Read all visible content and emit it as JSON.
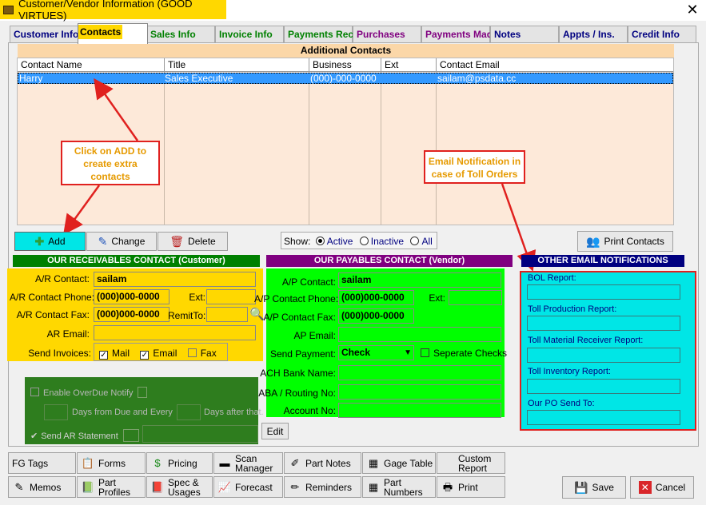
{
  "window": {
    "title": "Customer/Vendor Information  (GOOD VIRTUES)",
    "close": "✕"
  },
  "tabs": [
    {
      "label": "Customer Info",
      "color": "#000080"
    },
    {
      "label": "Contacts",
      "color": "#000000"
    },
    {
      "label": "Sales Info",
      "color": "#008000"
    },
    {
      "label": "Invoice Info",
      "color": "#008000"
    },
    {
      "label": "Payments Rec",
      "color": "#008000"
    },
    {
      "label": "Purchases",
      "color": "#800080"
    },
    {
      "label": "Payments Made",
      "color": "#800080"
    },
    {
      "label": "Notes",
      "color": "#000080"
    },
    {
      "label": "Appts / Ins.",
      "color": "#000080"
    },
    {
      "label": "Credit Info",
      "color": "#000080"
    }
  ],
  "additional_contacts": {
    "header": "Additional Contacts",
    "columns": [
      "Contact Name",
      "Title",
      "Business Phone",
      "Ext",
      "Contact Email"
    ],
    "rows": [
      [
        "Harry",
        "Sales Executive",
        "(000)-000-0000",
        "",
        "sailam@psdata.cc"
      ]
    ]
  },
  "callouts": {
    "add": "Click on ADD to create extra contacts",
    "email": "Email Notification in case of Toll Orders"
  },
  "actions": {
    "add": "Add",
    "change": "Change",
    "delete": "Delete",
    "print_contacts": "Print Contacts"
  },
  "show_filter": {
    "label": "Show:",
    "options": [
      "Active",
      "Inactive",
      "All"
    ],
    "selected": "Active"
  },
  "receivables": {
    "header": "OUR RECEIVABLES CONTACT (Customer)",
    "contact_label": "A/R Contact:",
    "contact": "sailam",
    "phone_label": "A/R Contact Phone:",
    "phone": "(000)000-0000",
    "ext_label": "Ext:",
    "ext": "",
    "fax_label": "A/R Contact Fax:",
    "fax": "(000)000-0000",
    "remit_label": "RemitTo:",
    "remit": "",
    "email_label": "AR Email:",
    "email": "",
    "send_label": "Send Invoices:",
    "send_mail": "Mail",
    "send_email": "Email",
    "send_fax": "Fax"
  },
  "overdue": {
    "enable": "Enable OverDue Notify",
    "days_from_due": "Days from Due and Every",
    "days_after": "Days after that.",
    "send_statement": "Send AR Statement",
    "edit": "Edit"
  },
  "payables": {
    "header": "OUR PAYABLES CONTACT (Vendor)",
    "contact_label": "A/P Contact:",
    "contact": "sailam",
    "phone_label": "A/P Contact Phone:",
    "phone": "(000)000-0000",
    "ext_label": "Ext:",
    "ext": "",
    "fax_label": "A/P Contact Fax:",
    "fax": "(000)000-0000",
    "email_label": "AP Email:",
    "email": "",
    "payment_label": "Send Payment:",
    "payment": "Check",
    "separate_checks": "Seperate Checks",
    "ach_label": "ACH Bank Name:",
    "aba_label": "ABA / Routing No:",
    "account_label": "Account No:"
  },
  "email_notifications": {
    "header": "OTHER EMAIL NOTIFICATIONS",
    "bol": "BOL Report:",
    "toll_production": "Toll Production Report:",
    "toll_material": "Toll Material Receiver Report:",
    "toll_inventory": "Toll Inventory Report:",
    "po_send": "Our PO Send To:"
  },
  "toolbar": {
    "fg_tags": "FG Tags",
    "forms": "Forms",
    "pricing": "Pricing",
    "scan_manager": "Scan Manager",
    "part_notes": "Part Notes",
    "gage_table": "Gage Table",
    "custom_report": "Custom Report",
    "memos": "Memos",
    "part_profiles": "Part Profiles",
    "spec_usages": "Spec & Usages",
    "forecast": "Forecast",
    "reminders": "Reminders",
    "part_numbers": "Part Numbers",
    "print": "Print",
    "save": "Save",
    "cancel": "Cancel"
  },
  "colors": {
    "highlight": "#ffd800",
    "receivables": "#008000",
    "payables": "#800080",
    "notifications": "#000080",
    "callout_border": "#e0211f"
  }
}
